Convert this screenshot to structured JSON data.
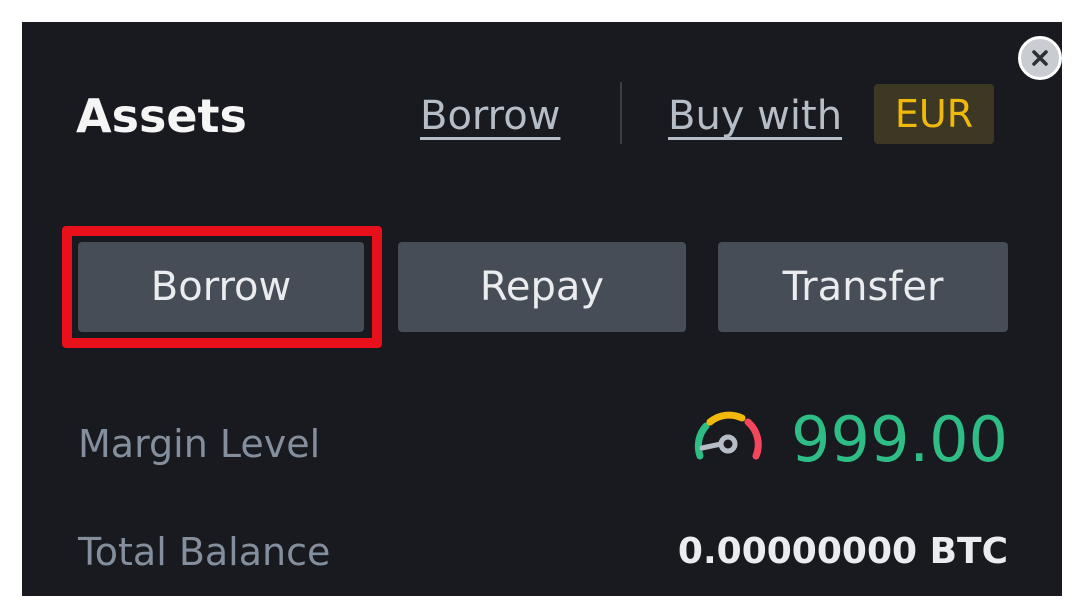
{
  "header": {
    "title": "Assets",
    "borrow_link": "Borrow",
    "buy_link": "Buy with ",
    "currency_badge": "EUR"
  },
  "actions": {
    "borrow": "Borrow",
    "repay": "Repay",
    "transfer": "Transfer"
  },
  "stats": {
    "margin_level_label": "Margin Level",
    "margin_level_value": "999.00",
    "total_balance_label": "Total Balance",
    "total_balance_value": "0.00000000 BTC"
  },
  "colors": {
    "panel_bg": "#181a20",
    "button_bg": "#474d57",
    "accent_yellow": "#f0b90b",
    "positive_green": "#2ebd85",
    "highlight_red": "#e8101a"
  },
  "icons": {
    "close": "close-icon",
    "gauge": "gauge-icon"
  }
}
